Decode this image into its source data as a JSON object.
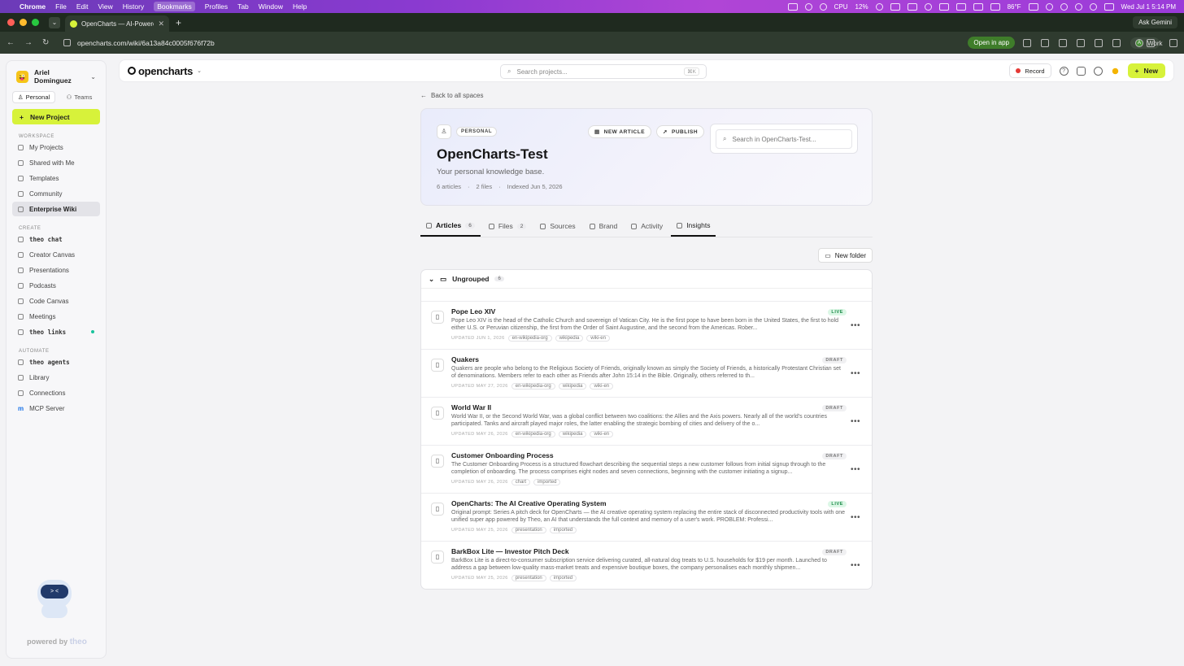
{
  "menubar": {
    "app": "Chrome",
    "items": [
      "File",
      "Edit",
      "View",
      "History",
      "Bookmarks",
      "Profiles",
      "Tab",
      "Window",
      "Help"
    ],
    "active_item": "Bookmarks",
    "cpu_label": "CPU",
    "cpu_value": "12%",
    "weather": "86°F",
    "datetime": "Wed Jul 1  5:14 PM"
  },
  "browser": {
    "tab_title": "OpenCharts — AI-Powered F",
    "ask_gemini": "Ask Gemini",
    "url": "opencharts.com/wiki/6a13a84c0005f676f72b",
    "open_in_app": "Open in app",
    "profile_initial": "A",
    "profile_name": "Work"
  },
  "sidebar": {
    "user_name": "Ariel Dominguez",
    "user_avatar": "😜",
    "seg_personal": "Personal",
    "seg_teams": "Teams",
    "new_project": "New Project",
    "workspace_label": "WORKSPACE",
    "workspace": [
      "My Projects",
      "Shared with Me",
      "Templates",
      "Community",
      "Enterprise Wiki"
    ],
    "create_label": "CREATE",
    "create": [
      "theo chat",
      "Creator Canvas",
      "Presentations",
      "Podcasts",
      "Code Canvas",
      "Meetings",
      "theo links"
    ],
    "automate_label": "AUTOMATE",
    "automate": [
      "theo agents",
      "Library",
      "Connections",
      "MCP Server"
    ],
    "mcp_icon_text": "m",
    "mascot_text": "theo",
    "powered_by": "powered by",
    "powered_brand": "theo"
  },
  "topbar": {
    "logo": "opencharts",
    "search_placeholder": "Search projects...",
    "search_kbd": "⌘K",
    "record": "Record",
    "new": "New"
  },
  "main": {
    "back": "Back to all spaces",
    "badge": "PERSONAL",
    "new_article": "NEW ARTICLE",
    "publish": "PUBLISH",
    "space_search_placeholder": "Search in OpenCharts-Test...",
    "title": "OpenCharts-Test",
    "description": "Your personal knowledge base.",
    "stat_articles": "6 articles",
    "stat_files": "2 files",
    "stat_indexed": "Indexed Jun 5, 2026",
    "stat_sep": "·",
    "tabs": {
      "articles": "Articles",
      "articles_count": "6",
      "files": "Files",
      "files_count": "2",
      "sources": "Sources",
      "brand": "Brand",
      "activity": "Activity",
      "insights": "Insights"
    },
    "new_folder": "New folder",
    "group_name": "Ungrouped",
    "group_count": "6",
    "articles": [
      {
        "title": "Pope Leo XIV",
        "status": "LIVE",
        "summary": "Pope Leo XIV is the head of the Catholic Church and sovereign of Vatican City. He is the first pope to have been born in the United States, the first to hold either U.S. or Peruvian citizenship, the first from the Order of Saint Augustine, and the second from the Americas. Rober...",
        "updated": "UPDATED JUN 1, 2026",
        "tags": [
          "en-wikipedia-org",
          "wikipedia",
          "wiki-en"
        ]
      },
      {
        "title": "Quakers",
        "status": "DRAFT",
        "summary": "Quakers are people who belong to the Religious Society of Friends, originally known as simply the Society of Friends, a historically Protestant Christian set of denominations. Members refer to each other as Friends after John 15:14 in the Bible. Originally, others referred to th...",
        "updated": "UPDATED MAY 27, 2026",
        "tags": [
          "en-wikipedia-org",
          "wikipedia",
          "wiki-en"
        ]
      },
      {
        "title": "World War II",
        "status": "DRAFT",
        "summary": "World War II, or the Second World War, was a global conflict between two coalitions: the Allies and the Axis powers. Nearly all of the world's countries participated. Tanks and aircraft played major roles, the latter enabling the strategic bombing of cities and delivery of the o...",
        "updated": "UPDATED MAY 26, 2026",
        "tags": [
          "en-wikipedia-org",
          "wikipedia",
          "wiki-en"
        ]
      },
      {
        "title": "Customer Onboarding Process",
        "status": "DRAFT",
        "summary": "The Customer Onboarding Process is a structured flowchart describing the sequential steps a new customer follows from initial signup through to the completion of onboarding. The process comprises eight nodes and seven connections, beginning with the customer initiating a signup...",
        "updated": "UPDATED MAY 26, 2026",
        "tags": [
          "chart",
          "imported"
        ]
      },
      {
        "title": "OpenCharts: The AI Creative Operating System",
        "status": "LIVE",
        "summary": "Original prompt: Series A pitch deck for OpenCharts — the AI creative operating system replacing the entire stack of disconnected productivity tools with one unified super app powered by Theo, an AI that understands the full context and memory of a user's work. PROBLEM: Professi...",
        "updated": "UPDATED MAY 25, 2026",
        "tags": [
          "presentation",
          "imported"
        ]
      },
      {
        "title": "BarkBox Lite — Investor Pitch Deck",
        "status": "DRAFT",
        "summary": "BarkBox Lite is a direct-to-consumer subscription service delivering curated, all-natural dog treats to U.S. households for $19 per month. Launched to address a gap between low-quality mass-market treats and expensive boutique boxes, the company personalises each monthly shipmen...",
        "updated": "UPDATED MAY 25, 2026",
        "tags": [
          "presentation",
          "imported"
        ]
      }
    ]
  }
}
